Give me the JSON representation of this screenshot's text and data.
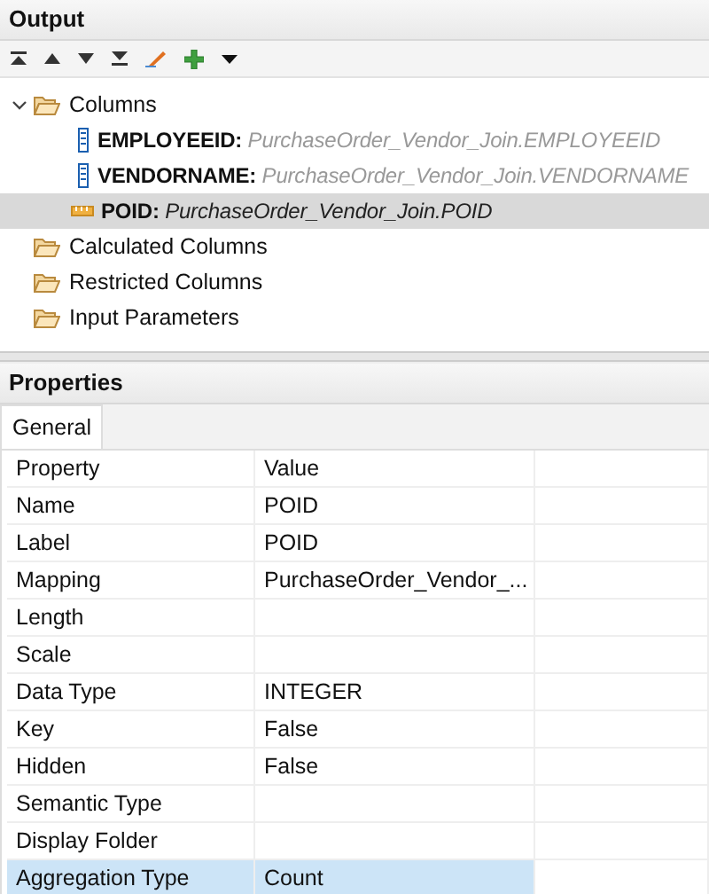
{
  "output_panel": {
    "title": "Output",
    "toolbar": [
      {
        "kind": "top"
      },
      {
        "kind": "up"
      },
      {
        "kind": "down"
      },
      {
        "kind": "bottom"
      },
      {
        "kind": "edit"
      },
      {
        "kind": "add"
      },
      {
        "kind": "menu"
      }
    ],
    "tree": [
      {
        "kind": "folder",
        "label": "Columns",
        "expanded": true,
        "selected": false,
        "children": [
          {
            "kind": "attribute",
            "label": "EMPLOYEEID:",
            "source": "PurchaseOrder_Vendor_Join.EMPLOYEEID",
            "selected": false
          },
          {
            "kind": "attribute",
            "label": "VENDORNAME:",
            "source": "PurchaseOrder_Vendor_Join.VENDORNAME",
            "selected": false
          },
          {
            "kind": "measure",
            "label": "POID:",
            "source": "PurchaseOrder_Vendor_Join.POID",
            "selected": true
          }
        ]
      },
      {
        "kind": "folder",
        "label": "Calculated Columns",
        "selected": false
      },
      {
        "kind": "folder",
        "label": "Restricted Columns",
        "selected": false
      },
      {
        "kind": "folder",
        "label": "Input Parameters",
        "selected": false
      }
    ]
  },
  "properties_panel": {
    "title": "Properties",
    "tabs": [
      {
        "label": "General",
        "selected": true
      }
    ],
    "columns": [
      "Property",
      "Value"
    ],
    "rows": [
      {
        "property": "Name",
        "value": "POID",
        "selected": false
      },
      {
        "property": "Label",
        "value": "POID",
        "selected": false
      },
      {
        "property": "Mapping",
        "value": "PurchaseOrder_Vendor_...",
        "selected": false
      },
      {
        "property": "Length",
        "selected": false
      },
      {
        "property": "Scale",
        "selected": false
      },
      {
        "property": "Data Type",
        "value": "INTEGER",
        "selected": false
      },
      {
        "property": "Key",
        "value": "False",
        "selected": false
      },
      {
        "property": "Hidden",
        "value": "False",
        "selected": false
      },
      {
        "property": "Semantic Type",
        "selected": false
      },
      {
        "property": "Display Folder",
        "selected": false
      },
      {
        "property": "Aggregation Type",
        "value": "Count",
        "selected": true
      }
    ]
  }
}
